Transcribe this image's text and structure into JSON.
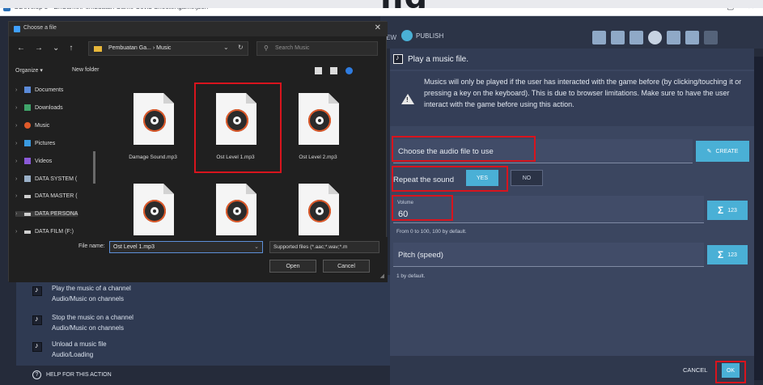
{
  "banner": {
    "big_text": "ng"
  },
  "app": {
    "title": "GDevelop 5 - E:\\Game\\Pembuatan Game Covid Shooter\\game.json *",
    "minimize": "–",
    "maximize": "▢",
    "close": "✕"
  },
  "toolbar": {
    "preview_fragment": "IEW",
    "publish_label": "PUBLISH"
  },
  "file_dialog": {
    "title": "Choose a file",
    "close": "✕",
    "nav_arrows": [
      "←",
      "→",
      "⌄",
      "↑"
    ],
    "path": "Pembuatan Ga...  ›  Music",
    "path_dropdown": "⌄",
    "refresh": "↻",
    "search_placeholder": "Search Music",
    "organize": "Organize ▾",
    "new_folder": "New folder",
    "sidebar": [
      {
        "label": "Documents",
        "color": "#5b8ad8"
      },
      {
        "label": "Downloads",
        "color": "#3fa46a"
      },
      {
        "label": "Music",
        "color": "#e05a2a"
      },
      {
        "label": "Pictures",
        "color": "#3a9ae0"
      },
      {
        "label": "Videos",
        "color": "#8b5ad8"
      },
      {
        "label": "DATA SYSTEM (",
        "color": "#9ab0c8"
      },
      {
        "label": "DATA MASTER (",
        "color": "#cfcfcf"
      },
      {
        "label": "DATA PERSONA",
        "color": "#cfcfcf"
      },
      {
        "label": "DATA FILM (F:)",
        "color": "#cfcfcf"
      }
    ],
    "files": [
      {
        "name": "Damage Sound.mp3"
      },
      {
        "name": "Ost Level 1.mp3"
      },
      {
        "name": "Ost Level 2.mp3"
      },
      {
        "name": ""
      },
      {
        "name": ""
      },
      {
        "name": ""
      }
    ],
    "filename_label": "File name:",
    "filename_value": "Ost Level 1.mp3",
    "filetype_value": "Supported files (*.aac;*.wav;*.m",
    "open_label": "Open",
    "cancel_label": "Cancel"
  },
  "events": [
    {
      "line1": "Play the music of a channel",
      "line2": "Audio/Music on channels"
    },
    {
      "line1": "Stop the music on a channel",
      "line2": "Audio/Music on channels"
    },
    {
      "line1": "Unload a music file",
      "line2": "Audio/Loading"
    }
  ],
  "help_label": "HELP FOR THIS ACTION",
  "action": {
    "title": "Play a music file.",
    "warning": "Musics will only be played if the user has interacted with the game before (by clicking/touching it or pressing a key on the keyboard). This is due to browser limitations. Make sure to have the user interact with the game before using this action.",
    "audio_label": "Choose the audio file to use",
    "create_label": "CREATE",
    "repeat_label": "Repeat the sound",
    "yes_label": "YES",
    "no_label": "NO",
    "volume_label": "Volume",
    "volume_value": "60",
    "volume_hint": "From 0 to 100, 100 by default.",
    "pitch_label": "Pitch (speed)",
    "pitch_hint": "1 by default.",
    "expr_sigma": "Σ",
    "expr_label": "123",
    "cancel_label": "CANCEL",
    "ok_label": "OK"
  },
  "colors": {
    "accent": "#4ab0d6",
    "highlight": "#d8141d",
    "dialog_bg": "#3b4660"
  }
}
